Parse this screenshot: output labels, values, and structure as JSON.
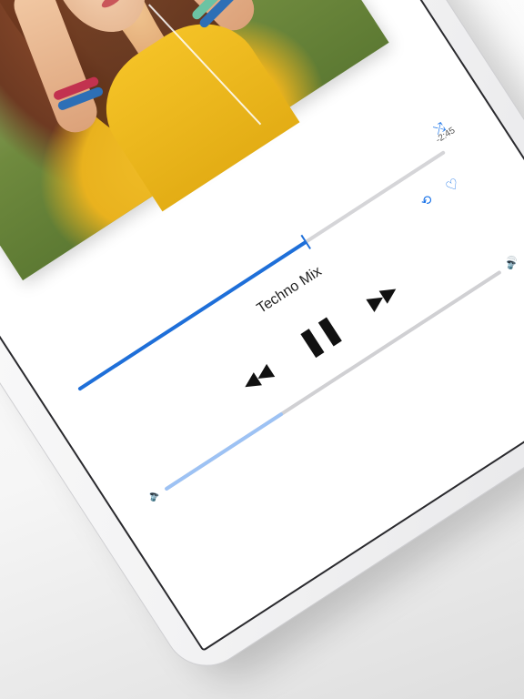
{
  "player": {
    "song_title": "Techno Mix",
    "time_remaining": "-2:45",
    "progress": 0.62,
    "volume": 0.35,
    "accent_color": "#1e6fd9"
  },
  "icons": {
    "shuffle": "shuffle-icon",
    "repeat": "repeat-icon",
    "heart": "heart-icon",
    "rewind": "rewind-icon",
    "pause": "pause-icon",
    "fast_forward": "fast-forward-icon",
    "volume_low": "volume-low-icon",
    "volume_high": "volume-high-icon"
  },
  "album_art": {
    "description_visible": "photo"
  }
}
